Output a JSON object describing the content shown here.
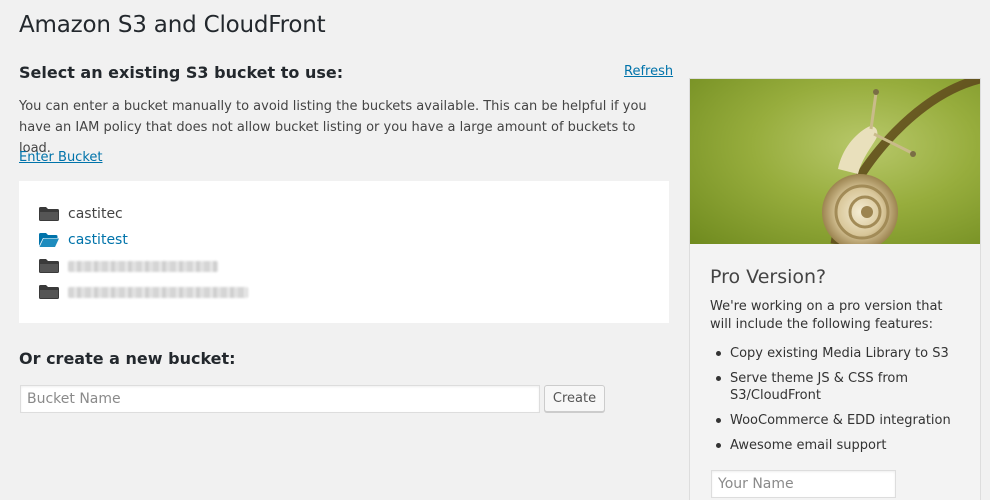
{
  "page": {
    "title": "Amazon S3 and CloudFront"
  },
  "select_bucket": {
    "heading": "Select an existing S3 bucket to use:",
    "refresh_label": "Refresh",
    "help_text": "You can enter a bucket manually to avoid listing the buckets available. This can be helpful if you have an IAM policy that does not allow bucket listing or you have a large amount of buckets to load.",
    "enter_bucket_label": "Enter Bucket",
    "buckets": [
      {
        "name": "castitec",
        "selected": false,
        "icon": "folder-icon"
      },
      {
        "name": "castitest",
        "selected": true,
        "icon": "folder-open-icon"
      },
      {
        "name": "",
        "obscured": true,
        "icon": "folder-icon"
      },
      {
        "name": "",
        "obscured": true,
        "icon": "folder-icon"
      }
    ]
  },
  "create_bucket": {
    "heading": "Or create a new bucket:",
    "input_placeholder": "Bucket Name",
    "button_label": "Create"
  },
  "sidebar": {
    "image": "snail-photo",
    "title": "Pro Version?",
    "intro": "We're working on a pro version that will include the following features:",
    "features": [
      "Copy existing Media Library to S3",
      "Serve theme JS & CSS from S3/CloudFront",
      "WooCommerce & EDD integration",
      "Awesome email support"
    ],
    "name_placeholder": "Your Name"
  },
  "colors": {
    "link": "#0073aa",
    "background": "#f1f1f1",
    "panel": "#ffffff"
  }
}
